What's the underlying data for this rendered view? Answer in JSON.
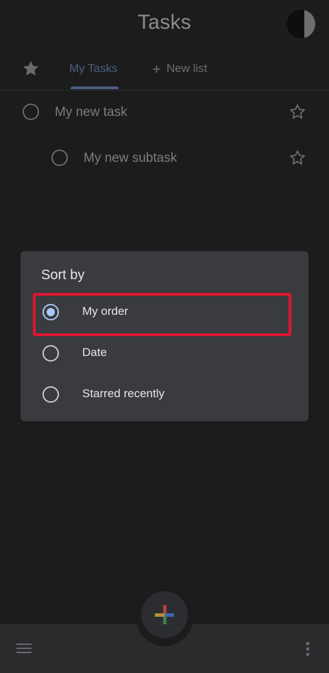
{
  "app": {
    "title": "Tasks"
  },
  "tabs": {
    "my_tasks": "My Tasks",
    "new_list": "New list",
    "new_list_icon": "plus-icon",
    "starred_icon": "star-filled-icon"
  },
  "tasks": [
    {
      "title": "My new task",
      "starred": false
    },
    {
      "title": "My new subtask",
      "starred": false,
      "subtask": true
    }
  ],
  "sort_dialog": {
    "title": "Sort by",
    "options": [
      {
        "label": "My order",
        "selected": true
      },
      {
        "label": "Date",
        "selected": false
      },
      {
        "label": "Starred recently",
        "selected": false
      }
    ],
    "highlight_color": "#e01530",
    "accent_color": "#aac7f5"
  },
  "bottom_bar": {
    "menu_icon": "menu-icon",
    "more_icon": "more-vert-icon",
    "fab_icon": "add-icon"
  }
}
